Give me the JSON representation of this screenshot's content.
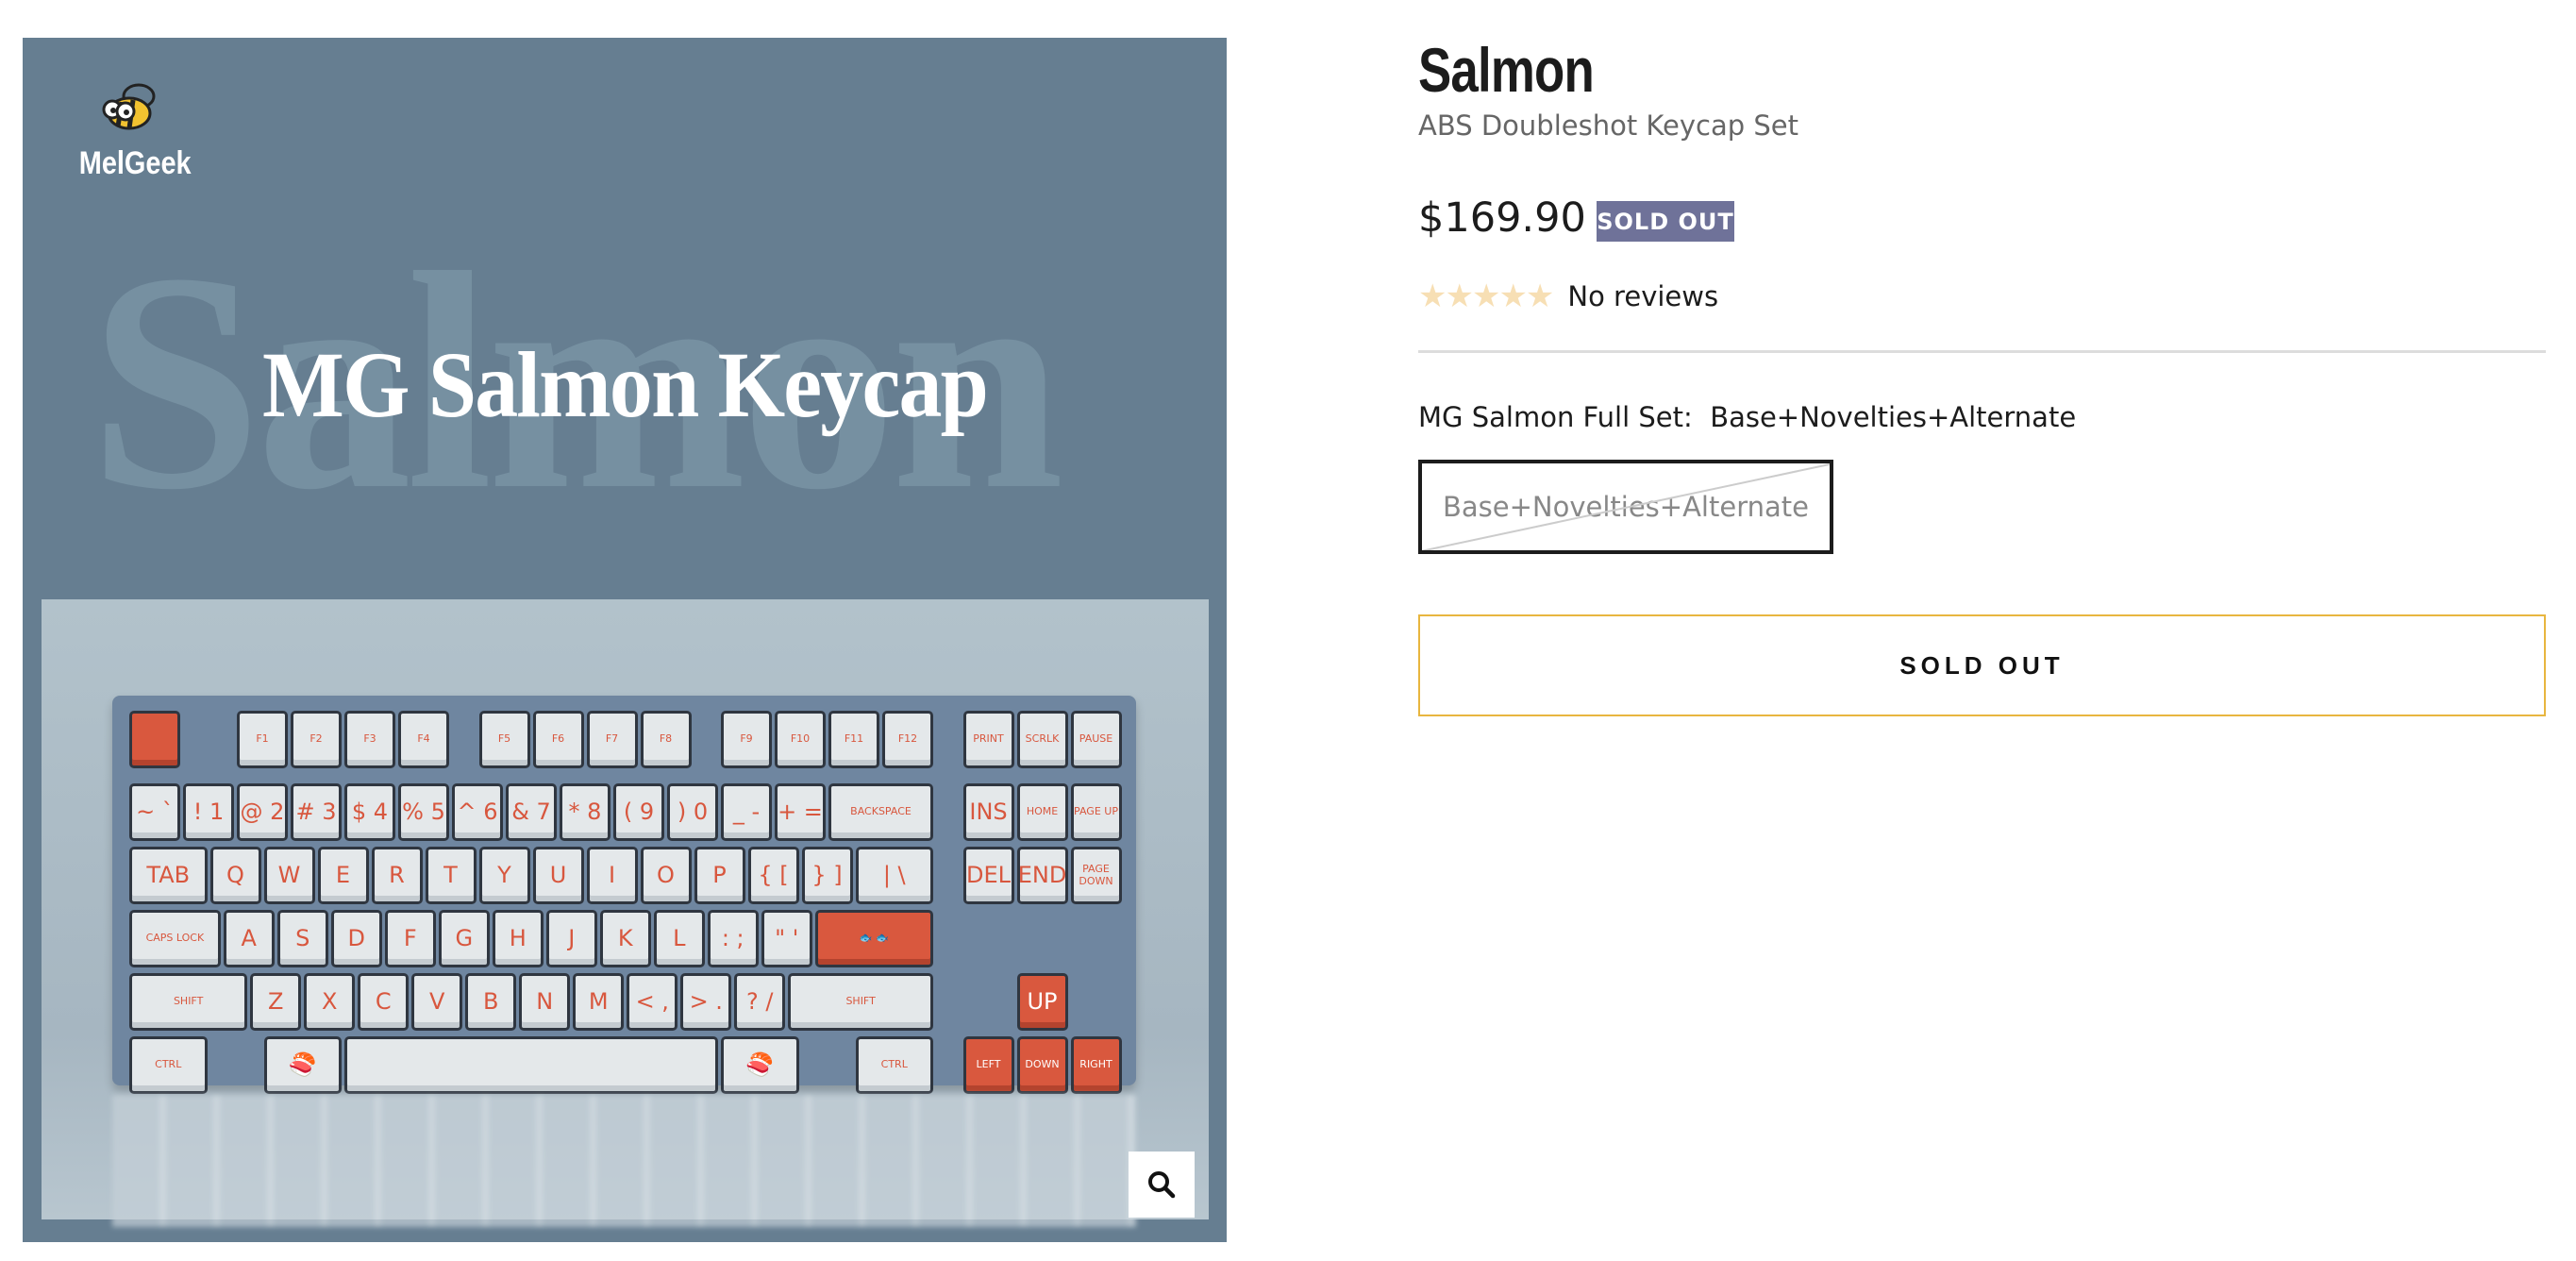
{
  "product": {
    "title": "Salmon",
    "subtitle": "ABS Doubleshot Keycap Set",
    "price": "$169.90",
    "badge": "SOLD OUT",
    "rating": {
      "stars": 0,
      "max": 5,
      "text": "No reviews"
    },
    "option": {
      "label": "MG Salmon Full Set:",
      "selected": "Base+Novelties+Alternate",
      "choices": [
        "Base+Novelties+Alternate"
      ]
    },
    "add_button": "SOLD OUT"
  },
  "media": {
    "logo": "MelGeek",
    "watermark": "Salmon",
    "banner": "MG Salmon Keycap",
    "keys": [
      [
        "",
        "F1",
        "F2",
        "F3",
        "F4",
        "F5",
        "F6",
        "F7",
        "F8",
        "F9",
        "F10",
        "F11",
        "F12",
        "PRINT",
        "SCRLK",
        "PAUSE"
      ],
      [
        "~ `",
        "! 1",
        "@ 2",
        "# 3",
        "$ 4",
        "% 5",
        "^ 6",
        "& 7",
        "* 8",
        "( 9",
        ") 0",
        "_ -",
        "+ =",
        "BACKSPACE",
        "INS",
        "HOME",
        "PAGE UP"
      ],
      [
        "TAB",
        "Q",
        "W",
        "E",
        "R",
        "T",
        "Y",
        "U",
        "I",
        "O",
        "P",
        "{ [",
        "} ]",
        "| \\",
        "DEL",
        "END",
        "PAGE DOWN"
      ],
      [
        "CAPS LOCK",
        "A",
        "S",
        "D",
        "F",
        "G",
        "H",
        "J",
        "K",
        "L",
        ": ;",
        "\" '",
        "🐟 🐟"
      ],
      [
        "SHIFT",
        "Z",
        "X",
        "C",
        "V",
        "B",
        "N",
        "M",
        "< ,",
        "> .",
        "? /",
        "SHIFT",
        "UP"
      ],
      [
        "CTRL",
        "🍣",
        "",
        "🍣",
        "CTRL",
        "LEFT",
        "DOWN",
        "RIGHT"
      ]
    ]
  }
}
